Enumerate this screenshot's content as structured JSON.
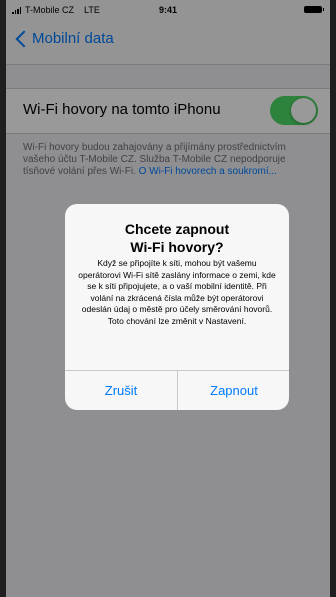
{
  "status_bar": {
    "carrier": "T-Mobile CZ",
    "network": "LTE",
    "time": "9:41"
  },
  "nav": {
    "back_label": "Mobilní data"
  },
  "wifi_calling": {
    "label": "Wi-Fi hovory na tomto iPhonu",
    "enabled": true,
    "footer_text": "Wi-Fi hovory budou zahajovány a přijímány prostřednictvím vašeho účtu T-Mobile CZ. Služba T-Mobile CZ nepodporuje tísňové volání přes Wi-Fi.",
    "footer_link": "O Wi-Fi hovorech a soukromí..."
  },
  "alert": {
    "title_line1": "Chcete zapnout",
    "title_line2": "Wi-Fi hovory?",
    "message": "Když se připojíte k síti, mohou být vašemu operátorovi Wi-Fi sítě zaslány informace o zemi, kde se k síti připojujete, a o vaší mobilní identitě. Při volání na zkrácená čísla může být operátorovi odeslán údaj o městě pro účely směrování hovorů. Toto chování lze změnit v Nastavení.",
    "cancel_label": "Zrušit",
    "confirm_label": "Zapnout"
  },
  "colors": {
    "accent": "#007aff",
    "toggle_on": "#4cd964",
    "background": "#efeff4"
  }
}
